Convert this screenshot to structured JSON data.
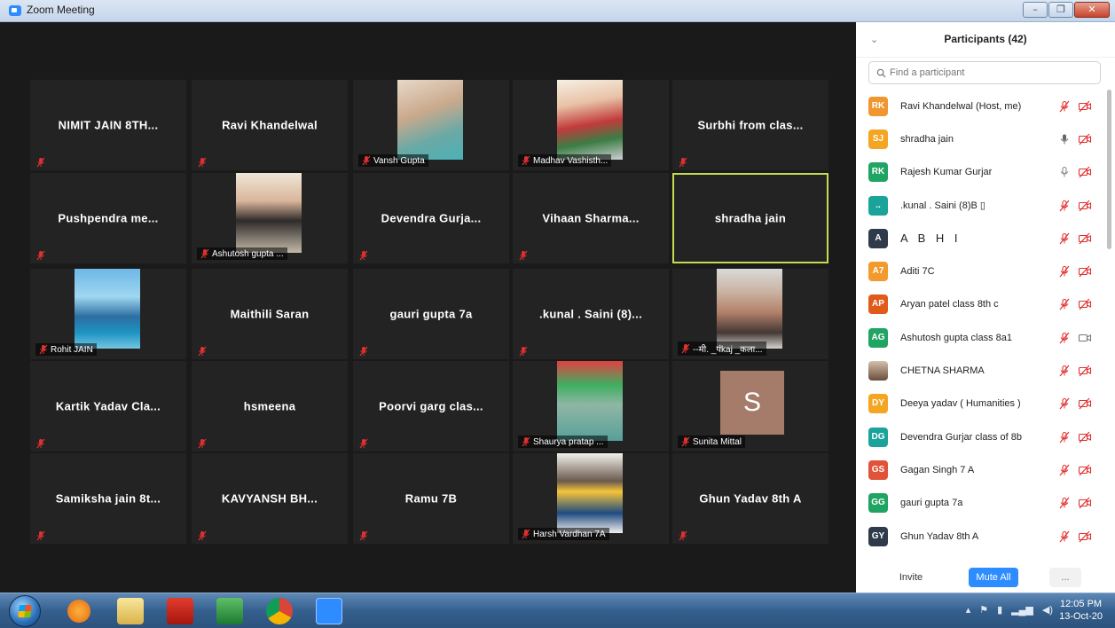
{
  "window": {
    "title": "Zoom Meeting"
  },
  "tiles": [
    {
      "name": "NIMIT JAIN 8TH...",
      "video": false
    },
    {
      "name": "Ravi Khandelwal",
      "video": false
    },
    {
      "name": "Vansh Gupta",
      "video": true
    },
    {
      "name": "Madhav Vashisth...",
      "video": true
    },
    {
      "name": "Surbhi from clas...",
      "video": false
    },
    {
      "name": "Pushpendra me...",
      "video": false
    },
    {
      "name": "Ashutosh gupta ...",
      "video": true
    },
    {
      "name": "Devendra Gurja...",
      "video": false
    },
    {
      "name": "Vihaan Sharma...",
      "video": false
    },
    {
      "name": "shradha jain",
      "video": false,
      "active": true
    },
    {
      "name": "Rohit JAIN",
      "video": true
    },
    {
      "name": "Maithili Saran",
      "video": false
    },
    {
      "name": "gauri gupta 7a",
      "video": false
    },
    {
      "name": ".kunal . Saini (8)...",
      "video": false
    },
    {
      "name": "--मी. _पंkaj _कला...",
      "video": true
    },
    {
      "name": "Kartik Yadav Cla...",
      "video": false
    },
    {
      "name": "hsmeena",
      "video": false
    },
    {
      "name": "Poorvi garg clas...",
      "video": false
    },
    {
      "name": "Shaurya pratap ...",
      "video": true
    },
    {
      "name": "Sunita Mittal",
      "video": true,
      "avatar_letter": "S"
    },
    {
      "name": "Samiksha jain 8t...",
      "video": false
    },
    {
      "name": "KAVYANSH BH...",
      "video": false
    },
    {
      "name": "Ramu 7B",
      "video": false
    },
    {
      "name": "Harsh Vardhan 7A",
      "video": true
    },
    {
      "name": "Ghun Yadav 8th A",
      "video": false
    }
  ],
  "panel": {
    "title": "Participants (42)",
    "search_placeholder": "Find a participant",
    "participants": [
      {
        "initials": "RK",
        "color": "#f0962e",
        "name": "Ravi Khandelwal (Host, me)",
        "mic": "muted",
        "video": "off"
      },
      {
        "initials": "SJ",
        "color": "#f4a623",
        "name": "shradha jain",
        "mic": "on-active",
        "video": "off"
      },
      {
        "initials": "RK",
        "color": "#1fa463",
        "name": "Rajesh Kumar Gurjar",
        "mic": "on",
        "video": "off"
      },
      {
        "initials": "..",
        "color": "#1aa39a",
        "name": ".kunal . Saini (8)B ▯",
        "mic": "muted",
        "video": "off"
      },
      {
        "initials": "A",
        "color": "#2f3a4a",
        "name": "A B H I",
        "mic": "muted",
        "video": "off"
      },
      {
        "initials": "A7",
        "color": "#f29a2e",
        "name": "Aditi 7C",
        "mic": "muted",
        "video": "off"
      },
      {
        "initials": "AP",
        "color": "#e05a1a",
        "name": "Aryan patel class 8th c",
        "mic": "muted",
        "video": "off"
      },
      {
        "initials": "AG",
        "color": "#1fa463",
        "name": "Ashutosh gupta class 8a1",
        "mic": "muted",
        "video": "on"
      },
      {
        "initials": "",
        "color": "photo",
        "name": "CHETNA SHARMA",
        "mic": "muted",
        "video": "off"
      },
      {
        "initials": "DY",
        "color": "#f4a623",
        "name": "Deeya yadav ( Humanities )",
        "mic": "muted",
        "video": "off"
      },
      {
        "initials": "DG",
        "color": "#1aa39a",
        "name": "Devendra Gurjar class of 8b",
        "mic": "muted",
        "video": "off"
      },
      {
        "initials": "GS",
        "color": "#e0533a",
        "name": "Gagan Singh 7 A",
        "mic": "muted",
        "video": "off"
      },
      {
        "initials": "GG",
        "color": "#1fa463",
        "name": "gauri gupta 7a",
        "mic": "muted",
        "video": "off"
      },
      {
        "initials": "GY",
        "color": "#2f3a4a",
        "name": "Ghun Yadav 8th A",
        "mic": "muted",
        "video": "off"
      }
    ],
    "invite_label": "Invite",
    "mute_all_label": "Mute All",
    "more_label": "..."
  },
  "taskbar": {
    "time": "12:05 PM",
    "date": "13-Oct-20"
  }
}
